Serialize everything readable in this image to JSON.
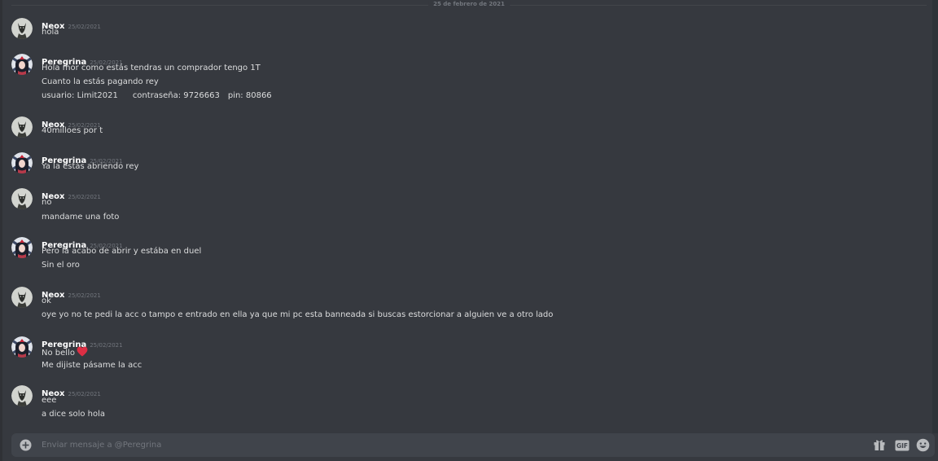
{
  "date_divider": "25 de febrero de 2021",
  "groups": [
    {
      "user": "Neox",
      "avatar": "neox",
      "time": "25/02/2021",
      "lines": [
        "hola"
      ]
    },
    {
      "user": "Peregrina",
      "avatar": "peregrina",
      "time": "25/02/2021",
      "lines": [
        "Hola mor como estás tendras un comprador tengo 1T",
        "Cuanto la estás pagando rey"
      ],
      "credentials": {
        "user": "usuario: Limit2021",
        "password": "contraseña: 9726663",
        "pin": "pin: 80866"
      }
    },
    {
      "user": "Neox",
      "avatar": "neox",
      "time": "25/02/2021",
      "lines": [
        "40milloes por t"
      ]
    },
    {
      "user": "Peregrina",
      "avatar": "peregrina",
      "time": "25/02/2021",
      "lines": [
        "Ya la estás abriendo rey"
      ]
    },
    {
      "user": "Neox",
      "avatar": "neox",
      "time": "25/02/2021",
      "lines": [
        "no",
        "mandame una foto"
      ]
    },
    {
      "user": "Peregrina",
      "avatar": "peregrina",
      "time": "25/02/2021",
      "lines": [
        "Pero la acabo de abrir y estába en duel",
        "Sin el oro"
      ]
    },
    {
      "user": "Neox",
      "avatar": "neox",
      "time": "25/02/2021",
      "lines": [
        "ok",
        "oye yo no te pedi la acc o tampo e entrado en ella ya que mi pc esta banneada si buscas estorcionar a alguien ve a otro lado"
      ]
    },
    {
      "user": "Peregrina",
      "avatar": "peregrina",
      "time": "25/02/2021",
      "lines": [
        "No bello",
        "Me dijiste pásame la acc"
      ],
      "emoji": "red-heart-icon"
    },
    {
      "user": "Neox",
      "avatar": "neox",
      "time": "25/02/2021",
      "lines": [
        "eee",
        "a dice solo hola"
      ]
    }
  ],
  "composer": {
    "placeholder": "Enviar mensaje a @Peregrina",
    "value": "",
    "icons": [
      "add-icon",
      "gift-icon",
      "gif-icon",
      "emoji-icon"
    ],
    "gif_label": "GIF"
  },
  "colors": {
    "background": "#36393f",
    "input": "#40444b",
    "username": "#ffffff",
    "text": "#dcddde",
    "muted": "#72767d",
    "heart": "#dd2e44"
  }
}
